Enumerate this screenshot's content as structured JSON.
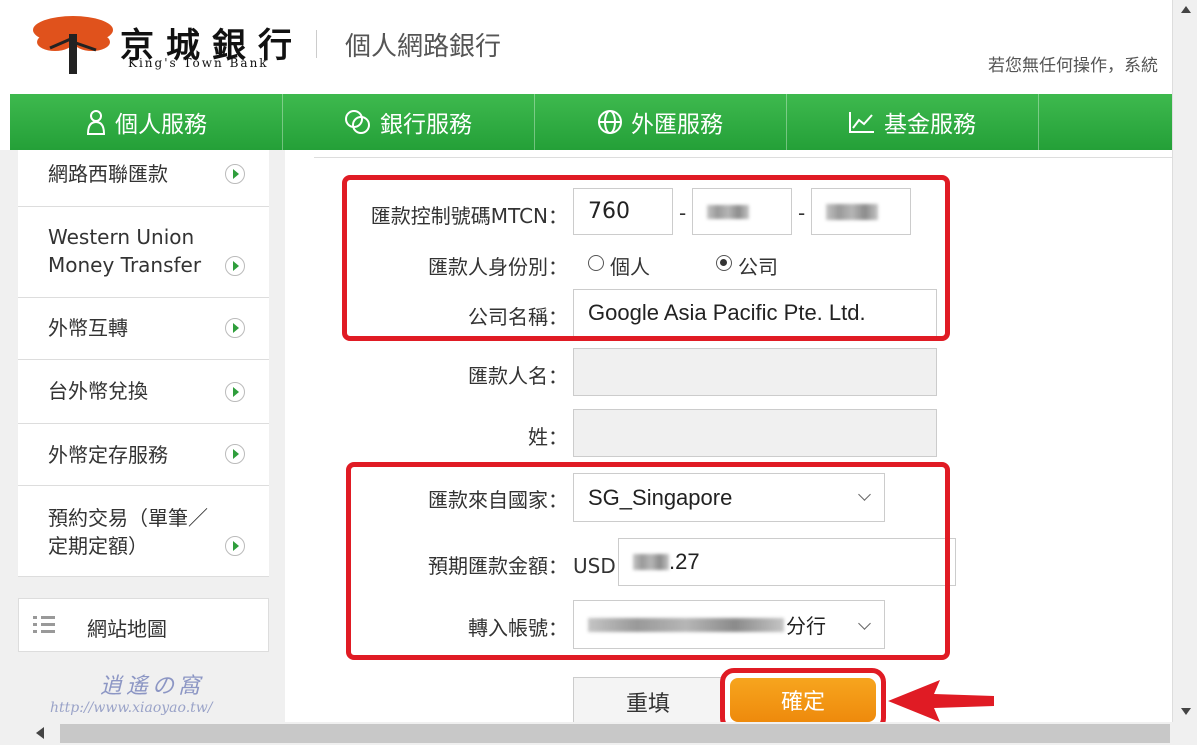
{
  "header": {
    "logo_cn": "京城銀行",
    "logo_en": "King's Town Bank",
    "site_title": "個人網路銀行",
    "timeout_notice": "若您無任何操作，系統"
  },
  "nav": {
    "items": [
      {
        "label": "個人服務",
        "icon": "person-icon"
      },
      {
        "label": "銀行服務",
        "icon": "coins-icon"
      },
      {
        "label": "外匯服務",
        "icon": "globe-icon"
      },
      {
        "label": "基金服務",
        "icon": "chart-icon"
      }
    ]
  },
  "sidebar": {
    "items": [
      {
        "label": "網路西聯匯款"
      },
      {
        "label": "Western Union\nMoney Transfer"
      },
      {
        "label": "外幣互轉"
      },
      {
        "label": "台外幣兌換"
      },
      {
        "label": "外幣定存服務"
      },
      {
        "label": "預約交易（單筆／\n定期定額）"
      }
    ],
    "sitemap_label": "網站地圖"
  },
  "form": {
    "mtcn_label": "匯款控制號碼MTCN：",
    "mtcn_part1": "760",
    "mtcn_sep": "-",
    "identity_label": "匯款人身份別：",
    "identity_options": [
      "個人",
      "公司"
    ],
    "identity_selected": "公司",
    "company_label": "公司名稱：",
    "company_value": "Google Asia Pacific Pte. Ltd.",
    "remitter_name_label": "匯款人名：",
    "surname_label": "姓：",
    "country_label": "匯款來自國家：",
    "country_value": "SG_Singapore",
    "amount_label": "預期匯款金額：",
    "amount_currency": "USD",
    "amount_suffix": ".27",
    "account_label": "轉入帳號：",
    "account_suffix": "分行",
    "reset_button": "重填",
    "confirm_button": "確定"
  },
  "watermark": "http://www.xiaoyao.tw/",
  "colors": {
    "nav_green": "#2fa83f",
    "highlight_red": "#e01b24",
    "confirm_orange": "#f39a14"
  }
}
